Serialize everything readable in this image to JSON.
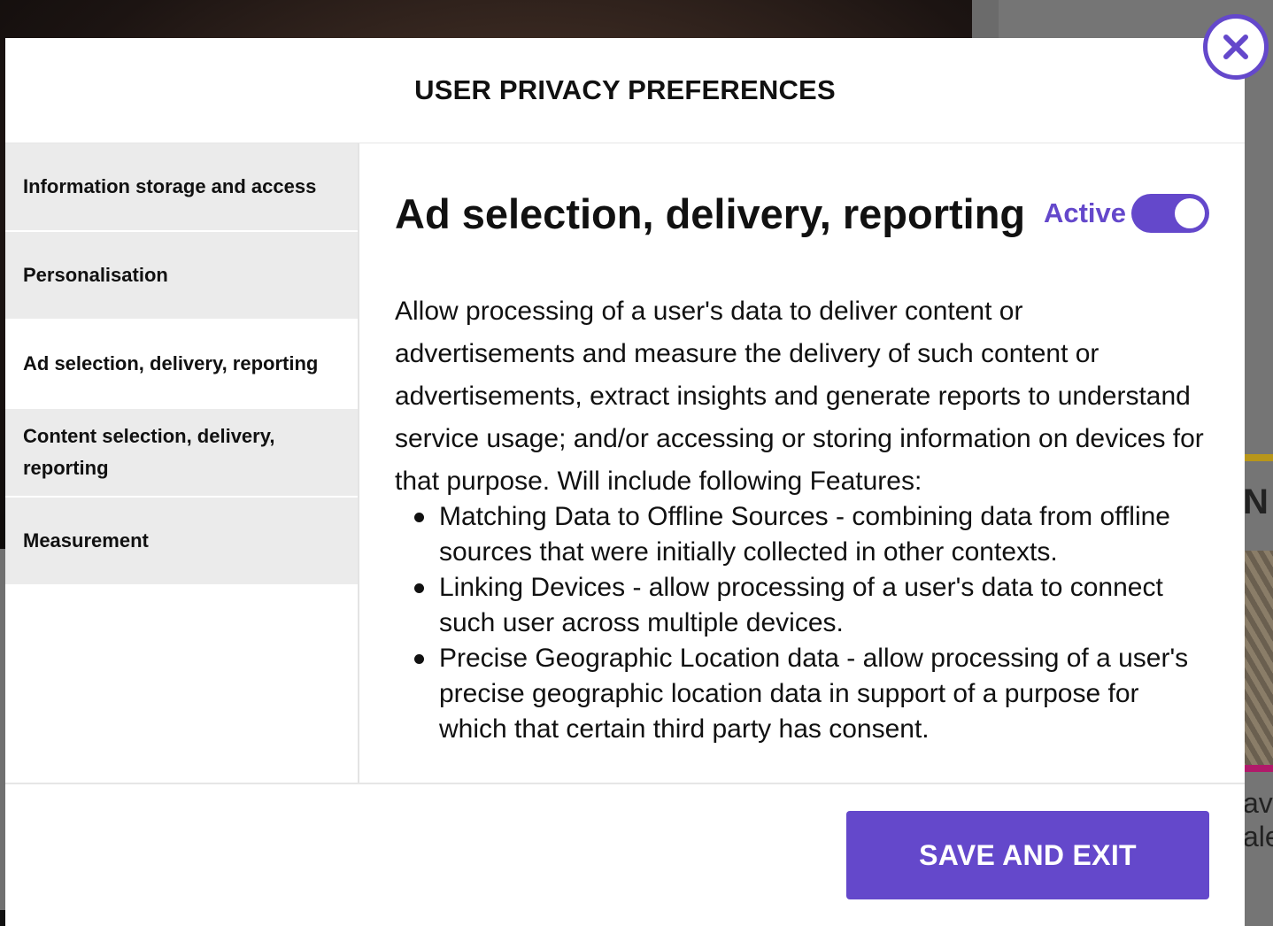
{
  "modal": {
    "title": "USER PRIVACY PREFERENCES",
    "close_icon": "close-icon"
  },
  "sidebar": {
    "items": [
      {
        "label": "Information storage and access",
        "active": false
      },
      {
        "label": "Personalisation",
        "active": false
      },
      {
        "label": "Ad selection, delivery, reporting",
        "active": true
      },
      {
        "label": "Content selection, delivery, reporting",
        "active": false
      },
      {
        "label": "Measurement",
        "active": false
      }
    ]
  },
  "content": {
    "title": "Ad selection, delivery, reporting",
    "toggle_label": "Active",
    "toggle_on": true,
    "description": "Allow processing of a user's data to deliver content or advertisements and measure the delivery of such content or advertisements, extract insights and generate reports to understand service usage; and/or accessing or storing information on devices for that purpose. Will include following Features:",
    "features": [
      "Matching Data to Offline Sources - combining data from offline sources that were initially collected in other contexts.",
      "Linking Devices - allow processing of a user's data to connect such user across multiple devices.",
      "Precise Geographic Location data - allow processing of a user's precise geographic location data in support of a purpose for which that certain third party has consent."
    ]
  },
  "footer": {
    "save_label": "SAVE AND EXIT"
  },
  "background": {
    "side_title": "N",
    "side_text_line1": "av",
    "side_text_line2": "ale"
  },
  "colors": {
    "accent": "#6448cb",
    "sidebar_bg": "#ebebeb"
  }
}
